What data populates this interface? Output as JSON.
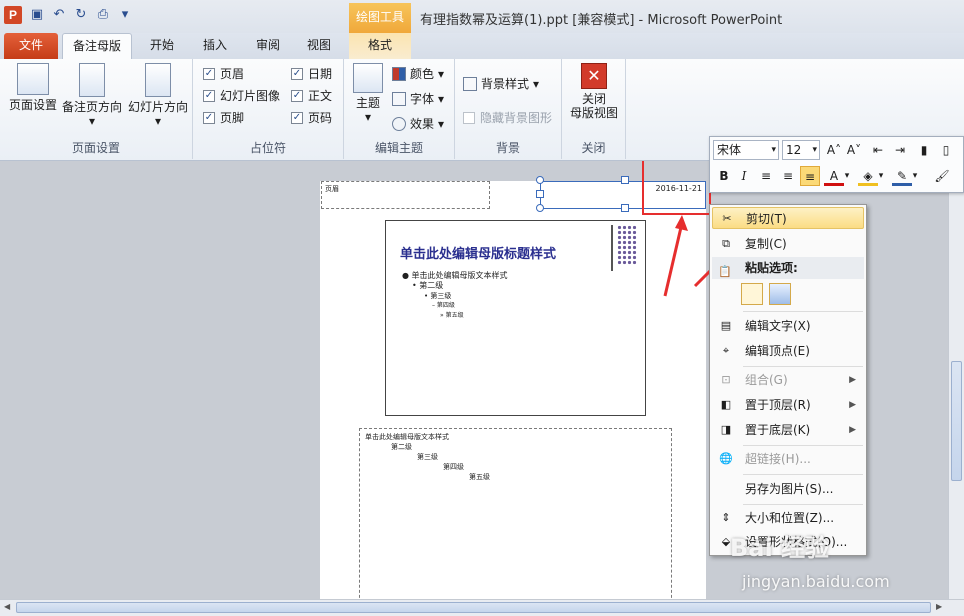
{
  "window": {
    "title": "有理指数幂及运算(1).ppt [兼容模式] - Microsoft PowerPoint",
    "app_icon_letter": "P",
    "context_tab_header": "绘图工具"
  },
  "tabs": [
    "文件",
    "备注母版",
    "开始",
    "插入",
    "审阅",
    "视图",
    "格式"
  ],
  "ribbon": {
    "page_setup_group": {
      "label": "页面设置",
      "buttons": [
        "页面设置",
        "备注页方向",
        "幻灯片方向"
      ]
    },
    "placeholders_group": {
      "label": "占位符",
      "checkboxes": [
        "页眉",
        "幻灯片图像",
        "页脚",
        "日期",
        "正文",
        "页码"
      ]
    },
    "edit_theme_group": {
      "label": "编辑主题",
      "theme_button": "主题",
      "options": [
        "颜色",
        "字体",
        "效果"
      ]
    },
    "background_group": {
      "label": "背景",
      "style_button": "背景样式",
      "hide_bg": "隐藏背景图形"
    },
    "close_group": {
      "label": "关闭",
      "close_button_line1": "关闭",
      "close_button_line2": "母版视图"
    }
  },
  "notes_page": {
    "header_text": "页眉",
    "date_text": "2016-11-21",
    "slide_title": "单击此处编辑母版标题样式",
    "slide_body": [
      "单击此处编辑母版文本样式",
      "第二级",
      "第三级",
      "第四级",
      "第五级"
    ],
    "notes_body": [
      "单击此处编辑母版文本样式",
      "第二级",
      "第三级",
      "第四级",
      "第五级"
    ]
  },
  "mini_toolbar": {
    "font": "宋体",
    "size": "12",
    "bold": "B",
    "italic": "I",
    "font_color_letter": "A"
  },
  "context_menu": {
    "cut": "剪切(T)",
    "copy": "复制(C)",
    "paste_options": "粘贴选项:",
    "edit_text": "编辑文字(X)",
    "edit_points": "编辑顶点(E)",
    "group": "组合(G)",
    "bring_to_front": "置于顶层(R)",
    "send_to_back": "置于底层(K)",
    "hyperlink": "超链接(H)...",
    "save_as_picture": "另存为图片(S)...",
    "size_position": "大小和位置(Z)...",
    "format_shape": "设置形状格式(O)..."
  },
  "watermark": {
    "brand": "Bai 经验",
    "url": "jingyan.baidu.com"
  },
  "colors": {
    "file_tab": "#c53c17",
    "context_tab": "#f0a83a",
    "highlight": "#e62e2e",
    "slide_title": "#2a2f8f"
  }
}
